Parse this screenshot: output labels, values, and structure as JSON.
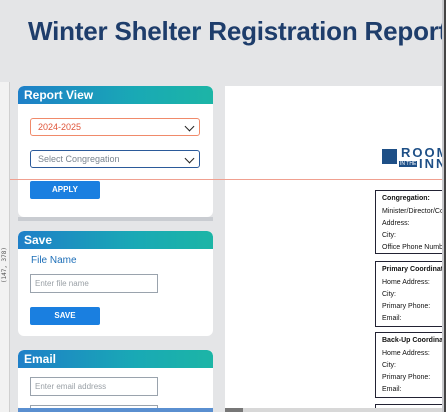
{
  "header": {
    "title": "Winter Shelter Registration Report"
  },
  "ruler": {
    "readout": "(147, 378)"
  },
  "report_view": {
    "heading": "Report View",
    "year_selected": "2024-2025",
    "congregation_placeholder": "Select Congregation",
    "apply_label": "APPLY"
  },
  "save_panel": {
    "heading": "Save",
    "file_name_label": "File Name",
    "file_name_placeholder": "Enter file name",
    "save_label": "SAVE"
  },
  "email_panel": {
    "heading": "Email",
    "email_placeholder": "Enter email address"
  },
  "document": {
    "logo": {
      "word_top": "ROOM",
      "word_small": "IN THE",
      "word_bottom": "INN"
    },
    "congregation_box": {
      "title": "Congregation:",
      "rows": [
        "Minister/Director/Co",
        "Address:",
        "City:",
        "Office Phone Numbe"
      ]
    },
    "primary_box": {
      "title": "Primary Coordinato",
      "rows": [
        "Home Address:",
        "City:",
        "Primary Phone:",
        "Email:"
      ]
    },
    "backup_box": {
      "title": "Back-Up Coordinato",
      "rows": [
        "Home Address:",
        "City:",
        "Primary Phone:",
        "Email:"
      ]
    }
  },
  "colors": {
    "title": "#1e3d6b",
    "accent_button": "#1a7fe0",
    "year_select_border": "#f08a6a",
    "year_select_text": "#e0553a",
    "logo": "#1e4f86"
  }
}
